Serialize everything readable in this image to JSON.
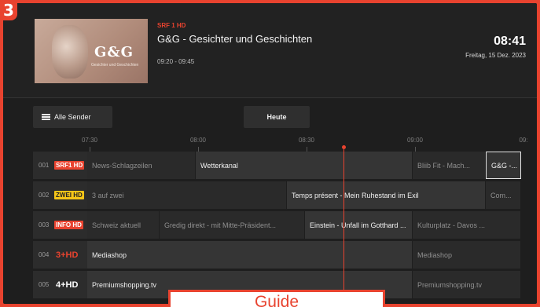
{
  "step_badge": "3",
  "header": {
    "thumbnail": {
      "logo": "G&G",
      "sub": "Gesichter und Geschichten"
    },
    "channel": "SRF 1 HD",
    "title": "G&G - Gesichter und Geschichten",
    "time": "09:20 - 09:45",
    "clock": "08:41",
    "date": "Freitag, 15 Dez. 2023"
  },
  "controls": {
    "all_channels": "Alle Sender",
    "today": "Heute"
  },
  "timeline": [
    "07:30",
    "08:00",
    "08:30",
    "09:00",
    "09:"
  ],
  "rows": [
    {
      "num": "001",
      "logo": "SRF1 HD",
      "logo_color": "#e8432f",
      "cells": [
        {
          "text": "News-Schlagzeilen"
        },
        {
          "text": "Wetterkanal",
          "now": true
        },
        {
          "text": "Bliib Fit - Mach..."
        },
        {
          "text": "G&G -...",
          "selected": true
        }
      ]
    },
    {
      "num": "002",
      "logo": "ZWEI HD",
      "logo_color": "#f5c518",
      "cells": [
        {
          "text": "3 auf zwei"
        },
        {
          "text": "Temps présent - Mein Ruhestand im Exil",
          "now": true
        },
        {
          "text": "Com..."
        }
      ]
    },
    {
      "num": "003",
      "logo": "INFO HD",
      "logo_color": "#e8432f",
      "cells": [
        {
          "text": "Schweiz aktuell"
        },
        {
          "text": "Gredig direkt - mit Mitte-Präsident..."
        },
        {
          "text": "Einstein - Unfall im Gotthard ...",
          "now": true
        },
        {
          "text": "Kulturplatz - Davos ..."
        }
      ]
    },
    {
      "num": "004",
      "logo": "3+HD",
      "logo_color": "#e8432f",
      "cells": [
        {
          "text": "Mediashop",
          "now": true
        },
        {
          "text": "Mediashop"
        }
      ]
    },
    {
      "num": "005",
      "logo": "4+HD",
      "logo_color": "#4caf50",
      "cells": [
        {
          "text": "Premiumshopping.tv",
          "now": true
        },
        {
          "text": "Premiumshopping.tv"
        }
      ]
    }
  ],
  "caption": "Guide",
  "colors": {
    "accent": "#e8432f",
    "background": "#1e1e1e"
  }
}
